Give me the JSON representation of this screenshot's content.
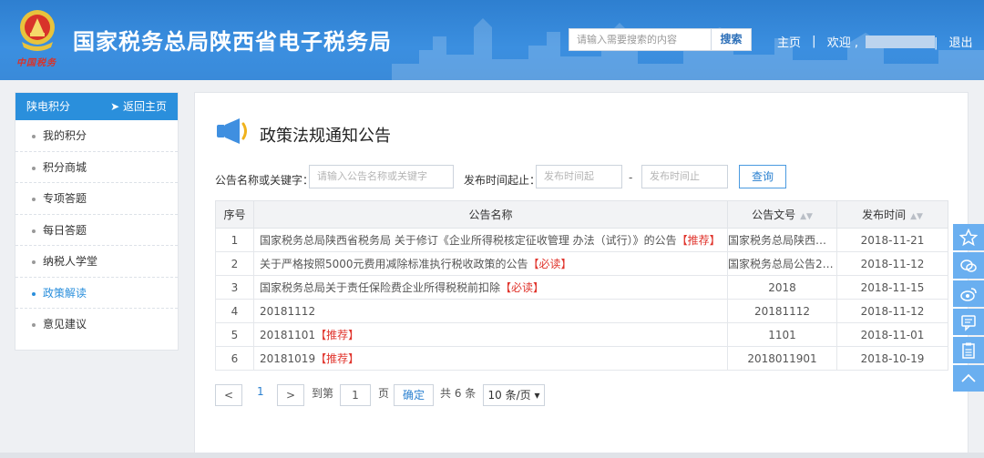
{
  "header": {
    "seal_text": "中国税务",
    "title": "国家税务总局陕西省电子税务局",
    "search": {
      "placeholder": "请输入需要搜索的内容",
      "button": "搜索"
    },
    "links": {
      "home": "主页",
      "welcome": "欢迎 ,",
      "logout": "退出"
    },
    "separator": "|"
  },
  "sidebar": {
    "title": "陕电积分",
    "back_label": "返回主页",
    "back_icon": "arrow-left-icon",
    "items": [
      {
        "label": "我的积分"
      },
      {
        "label": "积分商城"
      },
      {
        "label": "专项答题"
      },
      {
        "label": "每日答题"
      },
      {
        "label": "纳税人学堂"
      },
      {
        "label": "政策解读",
        "active": true
      },
      {
        "label": "意见建议"
      }
    ]
  },
  "main": {
    "icon": "megaphone-icon",
    "title": "政策法规通知公告",
    "filters": {
      "keyword_label": "公告名称或关键字：",
      "keyword_placeholder": "请输入公告名称或关键字",
      "date_label": "发布时间起止：",
      "date_start_placeholder": "发布时间起",
      "date_sep": "-",
      "date_end_placeholder": "发布时间止",
      "query_button": "查询"
    },
    "table": {
      "columns": [
        "序号",
        "公告名称",
        "公告文号",
        "发布时间"
      ],
      "rows": [
        {
          "no": "1",
          "name": "国家税务总局陕西省税务局 关于修订《企业所得税核定征收管理 办法（试行）》的公告",
          "tag": "【推荐】",
          "doc": "国家税务总局陕西省...",
          "date": "2018-11-21",
          "red": false
        },
        {
          "no": "2",
          "name": "关于严格按照5000元费用减除标准执行税收政策的公告",
          "tag": "【必读】",
          "doc": "国家税务总局公告20...",
          "date": "2018-11-12",
          "red": true
        },
        {
          "no": "3",
          "name": "国家税务总局关于责任保险费企业所得税税前扣除",
          "tag": "【必读】",
          "doc": "2018",
          "date": "2018-11-15",
          "red": false
        },
        {
          "no": "4",
          "name": "20181112",
          "tag": "",
          "doc": "20181112",
          "date": "2018-11-12",
          "red": false
        },
        {
          "no": "5",
          "name": "20181101",
          "tag": "【推荐】",
          "doc": "1101",
          "date": "2018-11-01",
          "red": false
        },
        {
          "no": "6",
          "name": "20181019",
          "tag": "【推荐】",
          "doc": "2018011901",
          "date": "2018-10-19",
          "red": true
        }
      ]
    },
    "pager": {
      "prev": "<",
      "current": "1",
      "next": ">",
      "goto_label": "到第",
      "goto_value": "1",
      "page_unit": "页",
      "confirm": "确定",
      "total": "共 6 条",
      "page_size": "10 条/页 ▾"
    }
  },
  "float_toolbar": [
    "star-icon",
    "chat-icon",
    "weibo-icon",
    "comment-icon",
    "document-icon",
    "chevron-up-icon"
  ]
}
